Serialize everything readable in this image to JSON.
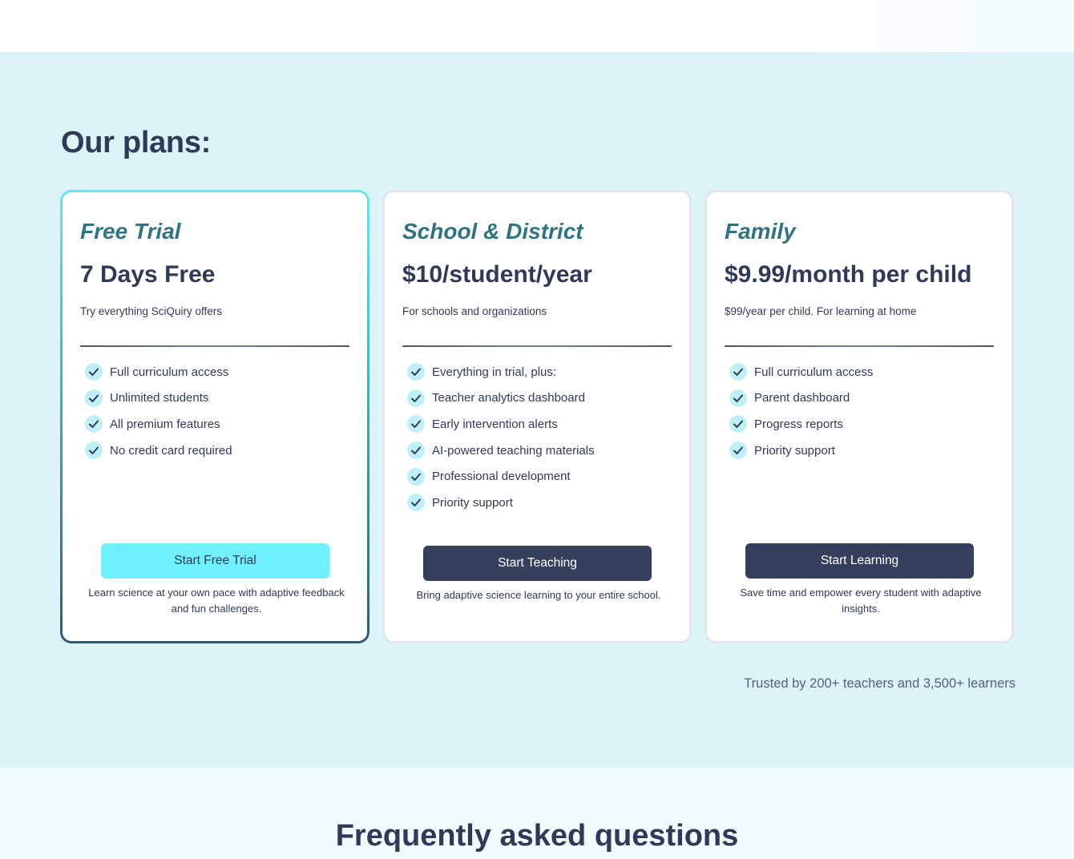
{
  "section_title": "Our plans:",
  "plans": [
    {
      "name": "Free Trial",
      "price": "7 Days Free",
      "description": "Try everything SciQuiry offers",
      "features": [
        "Full curriculum access",
        "Unlimited students",
        "All premium features",
        "No credit card required"
      ],
      "cta_label": "Start Free Trial",
      "cta_note": "Learn science at your own pace with adaptive feedback and fun challenges."
    },
    {
      "name": "School & District",
      "price": "$10/student/year",
      "description": "For schools and organizations",
      "features": [
        "Everything in trial, plus:",
        "Teacher analytics dashboard",
        "Early intervention alerts",
        "AI-powered teaching materials",
        "Professional development",
        "Priority support"
      ],
      "cta_label": "Start Teaching",
      "cta_note": "Bring adaptive science learning to your entire school."
    },
    {
      "name": "Family",
      "price": "$9.99/month per child",
      "description": "$99/year per child. For learning at home",
      "features": [
        "Full curriculum access",
        "Parent dashboard",
        "Progress reports",
        "Priority support"
      ],
      "cta_label": "Start Learning",
      "cta_note": "Save time and empower every student with adaptive insights."
    }
  ],
  "trusted_text": "Trusted by 200+ teachers and 3,500+ learners",
  "faq_title": "Frequently asked questions",
  "colors": {
    "section_bg": "#dcf4f8",
    "accent_cyan": "#6ff0fb",
    "navy": "#36405c",
    "plan_name": "#2f7480"
  },
  "icons": {
    "feature_check": "check-icon"
  }
}
